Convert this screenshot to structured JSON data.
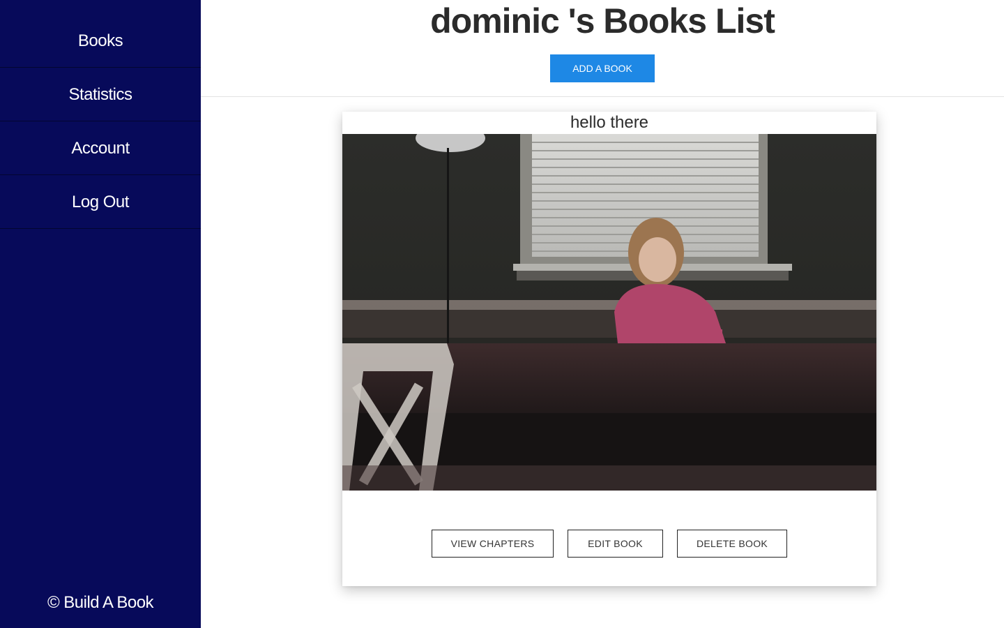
{
  "sidebar": {
    "items": [
      {
        "label": "Books"
      },
      {
        "label": "Statistics"
      },
      {
        "label": "Account"
      },
      {
        "label": "Log Out"
      }
    ],
    "footer": "© Build A Book",
    "background": "#070a5a"
  },
  "header": {
    "title": "dominic 's Books List",
    "add_button_label": "ADD A BOOK",
    "accent": "#1e88e5"
  },
  "book": {
    "title": "hello there",
    "image_description_icon": "book-cover-photo",
    "actions": {
      "view": "VIEW CHAPTERS",
      "edit": "EDIT BOOK",
      "delete": "DELETE BOOK"
    }
  }
}
